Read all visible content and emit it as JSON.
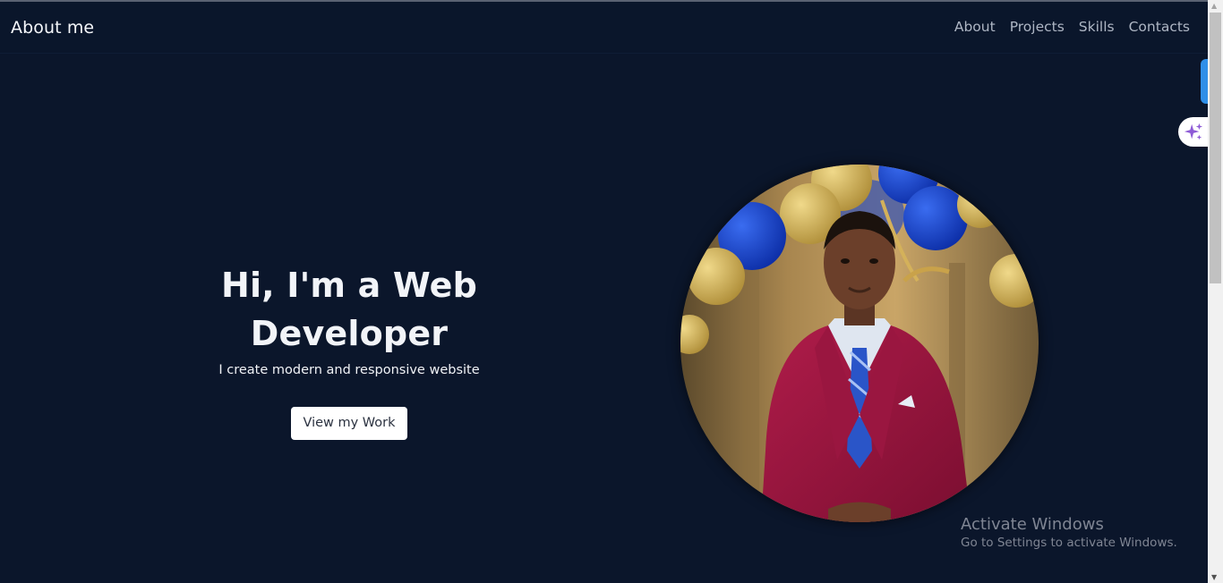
{
  "nav": {
    "brand": "About me",
    "links": [
      "About",
      "Projects",
      "Skills",
      "Contacts"
    ]
  },
  "hero": {
    "title": "Hi, I'm a Web Developer",
    "subtitle": "I create modern and responsive website",
    "button_label": "View my Work"
  },
  "watermark": {
    "title": "Activate Windows",
    "subtitle": "Go to Settings to activate Windows."
  },
  "icons": {
    "assistant": "sparkle-icon",
    "scroll_up": "chevron-up-icon",
    "scroll_down": "chevron-down-icon"
  },
  "colors": {
    "background": "#0b162b",
    "button_bg": "#ffffff",
    "accent_tab": "#2f8fe8",
    "sparkle": "#8e5bd6"
  }
}
